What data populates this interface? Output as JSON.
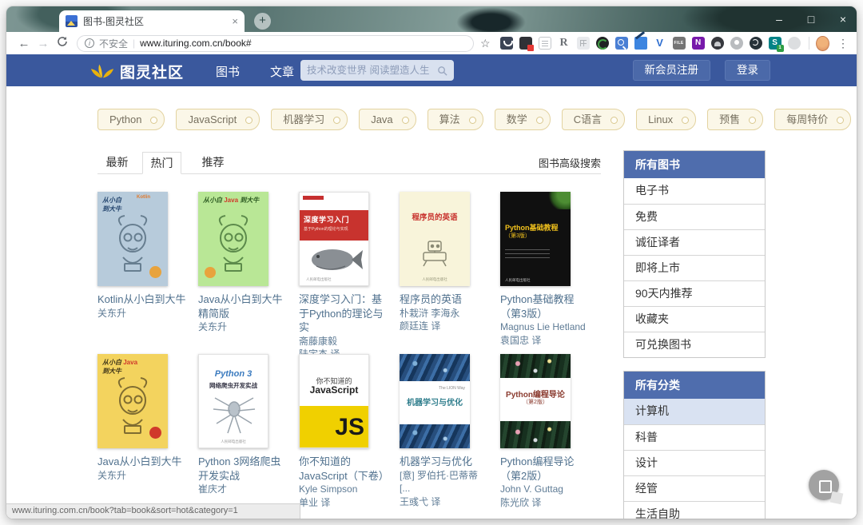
{
  "icons": {
    "back": "←",
    "forward": "→",
    "star": "☆",
    "menu": "⋮",
    "minimize": "–",
    "maximize": "□",
    "close": "×",
    "tab_close": "×",
    "new_tab": "+",
    "info": "i"
  },
  "browser": {
    "tab_title": "图书-图灵社区",
    "security_label": "不安全",
    "url": "www.ituring.com.cn/book#",
    "status_url": "www.ituring.com.cn/book?tab=book&sort=hot&category=1",
    "ext_labels": {
      "r": "R",
      "v": "V",
      "file": "FILE",
      "n": "N",
      "s": "S",
      "one": "1"
    }
  },
  "header": {
    "brand": "图灵社区",
    "nav_books": "图书",
    "nav_articles": "文章",
    "search_placeholder": "技术改变世界 阅读塑造人生",
    "register_label": "新会员注册",
    "login_label": "登录"
  },
  "tags": [
    "Python",
    "JavaScript",
    "机器学习",
    "Java",
    "算法",
    "数学",
    "C语言",
    "Linux",
    "预售",
    "每周特价"
  ],
  "tabs": {
    "latest": "最新",
    "hot": "热门",
    "recommend": "推荐",
    "advanced_search": "图书高级搜索"
  },
  "books": [
    {
      "title": "Kotlin从小白到大牛",
      "authors": [
        "关东升"
      ],
      "cover": {
        "l1": "从小白",
        "l2": "到大牛",
        "l3": "Kotlin"
      }
    },
    {
      "title": "Java从小白到大牛 精简版",
      "authors": [
        "关东升"
      ],
      "cover": {
        "l1": "从小白",
        "l2": "Java",
        "l3": "到大牛"
      }
    },
    {
      "title": "深度学习入门：基于Python的理论与实",
      "authors": [
        "斋藤康毅",
        "陆宇杰 译"
      ],
      "cover": {
        "l1": "深度学习入门",
        "l2": "基于Python的理论与实现",
        "l3": "人民邮电出版社"
      }
    },
    {
      "title": "程序员的英语",
      "authors": [
        "朴栽浒 李海永",
        "颜廷连 译"
      ],
      "cover": {
        "l1": "程序员的英语",
        "l2": "人民邮电出版社"
      }
    },
    {
      "title": "Python基础教程 （第3版）",
      "authors": [
        "Magnus Lie Hetland",
        "袁国忠 译"
      ],
      "cover": {
        "l1": "Python基础教程",
        "l2": "（第3版）",
        "l3": "人民邮电出版社"
      }
    },
    {
      "title": "Java从小白到大牛",
      "authors": [
        "关东升"
      ],
      "cover": {
        "l1": "从小白",
        "l2": "Java",
        "l3": "到大牛"
      }
    },
    {
      "title": "Python 3网络爬虫 开发实战",
      "authors": [
        "崔庆才"
      ],
      "cover": {
        "l1": "Python 3",
        "l2": "网络爬虫开发实战",
        "l3": "人民邮电出版社"
      }
    },
    {
      "title": "你不知道的 JavaScript（下卷）",
      "authors": [
        "Kyle Simpson",
        "单业 译"
      ],
      "cover": {
        "l1": "你不知道的",
        "l2": "JavaScript",
        "l3": "JS"
      }
    },
    {
      "title": "机器学习与优化",
      "authors": [
        "[意] 罗伯托·巴蒂蒂 [...",
        "王彧弋 译"
      ],
      "cover": {
        "l1": "The LION Way",
        "l2": "机器学习与优化"
      }
    },
    {
      "title": "Python编程导论 （第2版）",
      "authors": [
        "John V. Guttag",
        "陈光欣 译"
      ],
      "cover": {
        "l1": "Python编程导论",
        "l2": "（第2版）"
      }
    }
  ],
  "sidebar_books": {
    "header": "所有图书",
    "items": [
      "电子书",
      "免费",
      "诚征译者",
      "即将上市",
      "90天内推荐",
      "收藏夹",
      "可兑换图书"
    ]
  },
  "sidebar_categories": {
    "header": "所有分类",
    "items": [
      "计算机",
      "科普",
      "设计",
      "经管",
      "生活自助"
    ]
  },
  "colors": {
    "header_bg": "#3a589d",
    "header_button_bg": "#4b69a9",
    "sidebar_header_bg": "#4f6dad",
    "sidebar_active_bg": "#d9e2f2",
    "tag_bg": "#fbf7e8",
    "tag_border": "#e3d3a0",
    "book_link": "#50718e"
  }
}
